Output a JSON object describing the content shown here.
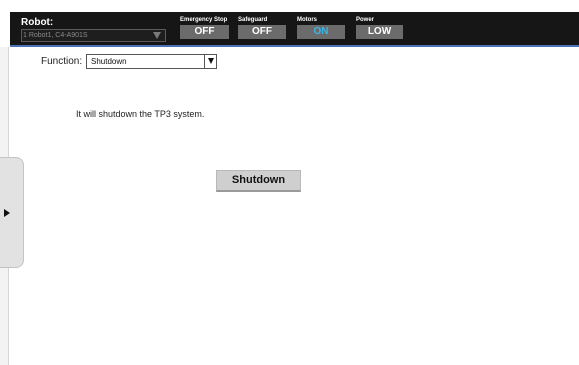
{
  "header": {
    "robot_label": "Robot:",
    "robot_selected": "1 Robot1, C4-A901S"
  },
  "status": [
    {
      "label": "Emergency Stop",
      "value": "OFF"
    },
    {
      "label": "Safeguard",
      "value": "OFF"
    },
    {
      "label": "Motors",
      "value": "ON"
    },
    {
      "label": "Power",
      "value": "LOW"
    }
  ],
  "colors": {
    "topbar_bg": "#161616",
    "status_bg": "#6b6b6b",
    "motors_on": "#39b7e6",
    "accent_line": "#4a72b8"
  },
  "function": {
    "label": "Function:",
    "selected": "Shutdown"
  },
  "main": {
    "description": "It will shutdown the TP3 system.",
    "shutdown_button": "Shutdown"
  },
  "icons": {
    "robot_dropdown": "chevron-down-icon",
    "function_dropdown": "chevron-down-icon",
    "side_panel_toggle": "play-arrow-icon"
  }
}
